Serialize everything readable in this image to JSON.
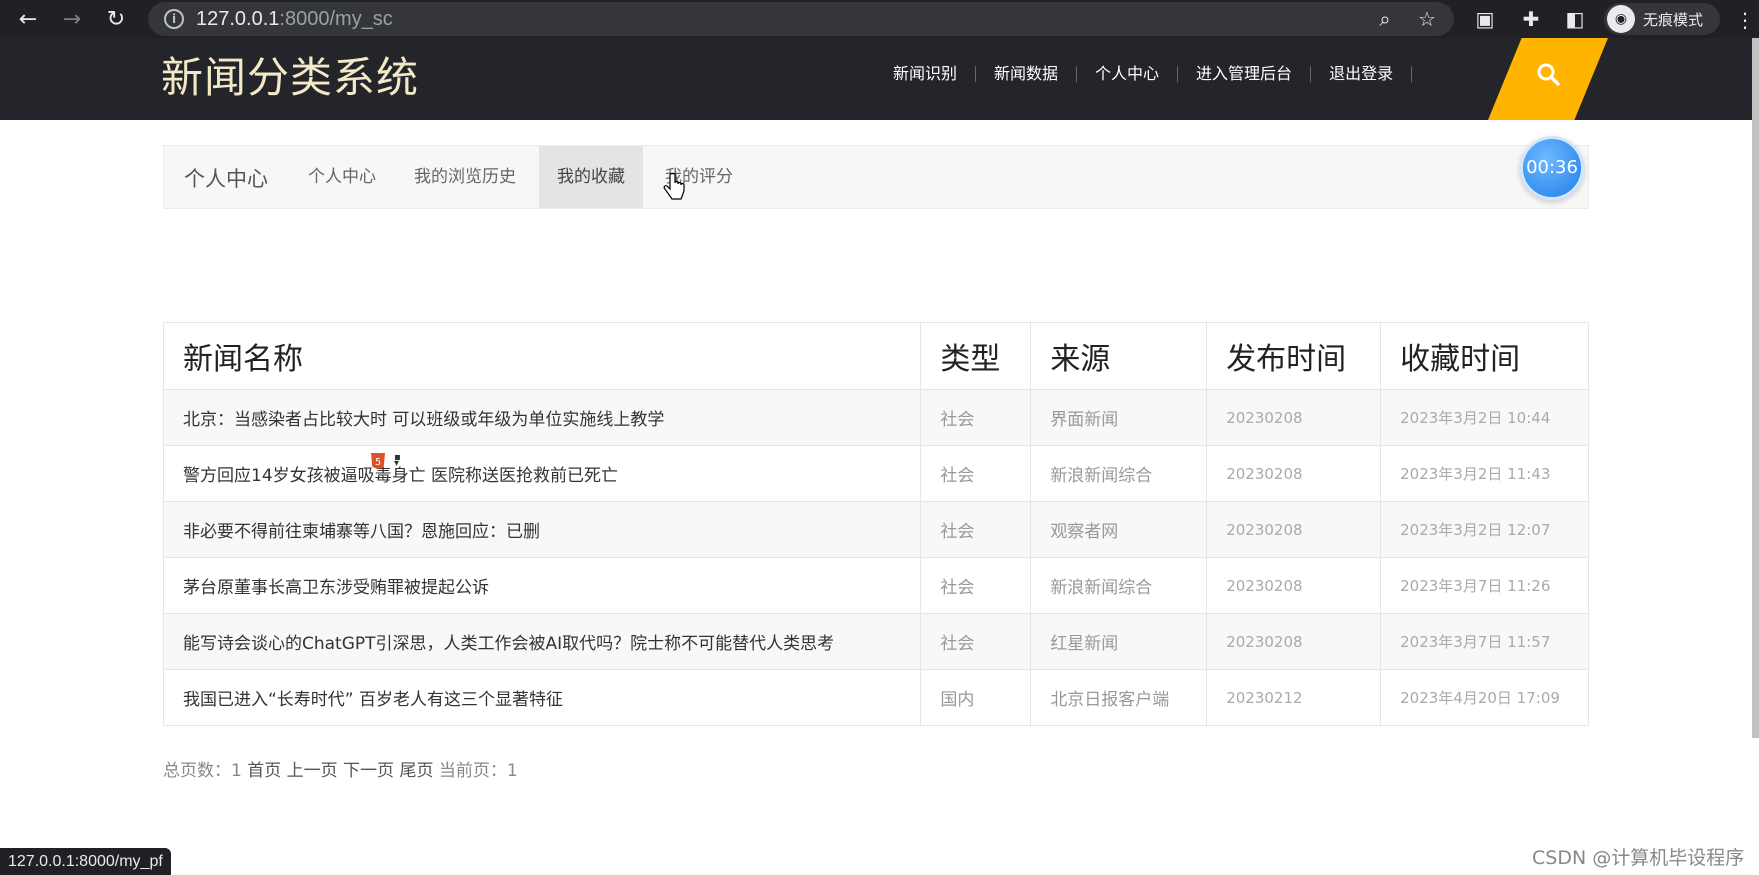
{
  "browser": {
    "url_host": "127.0.0.1",
    "url_rest": ":8000/my_sc",
    "incognito_label": "无痕模式"
  },
  "site": {
    "logo": "新闻分类系统",
    "nav": [
      "新闻识别",
      "新闻数据",
      "个人中心",
      "进入管理后台",
      "退出登录"
    ],
    "accent_color": "#ffb400"
  },
  "subnav": {
    "title": "个人中心",
    "links": [
      "个人中心",
      "我的浏览历史",
      "我的收藏",
      "我的评分"
    ],
    "active": "我的收藏"
  },
  "timer": "00:36",
  "table": {
    "headers": [
      "新闻名称",
      "类型",
      "来源",
      "发布时间",
      "收藏时间"
    ],
    "rows": [
      [
        "北京：当感染者占比较大时 可以班级或年级为单位实施线上教学",
        "社会",
        "界面新闻",
        "20230208",
        "2023年3月2日 10:44"
      ],
      [
        "警方回应14岁女孩被逼吸毒身亡 医院称送医抢救前已死亡",
        "社会",
        "新浪新闻综合",
        "20230208",
        "2023年3月2日 11:43"
      ],
      [
        "非必要不得前往柬埔寨等八国？恩施回应：已删",
        "社会",
        "观察者网",
        "20230208",
        "2023年3月2日 12:07"
      ],
      [
        "茅台原董事长高卫东涉受贿罪被提起公诉",
        "社会",
        "新浪新闻综合",
        "20230208",
        "2023年3月7日 11:26"
      ],
      [
        "能写诗会谈心的ChatGPT引深思，人类工作会被AI取代吗？院士称不可能替代人类思考",
        "社会",
        "红星新闻",
        "20230208",
        "2023年3月7日 11:57"
      ],
      [
        "我国已进入“长寿时代” 百岁老人有这三个显著特征",
        "国内",
        "北京日报客户端",
        "20230212",
        "2023年4月20日 17:09"
      ]
    ]
  },
  "pager": {
    "total_label": "总页数：",
    "total": "1",
    "first": "首页",
    "prev": "上一页",
    "next": "下一页",
    "last": "尾页",
    "current_label": "当前页：",
    "current": "1"
  },
  "status_url": "127.0.0.1:8000/my_pf",
  "watermark": "CSDN @计算机毕设程序"
}
